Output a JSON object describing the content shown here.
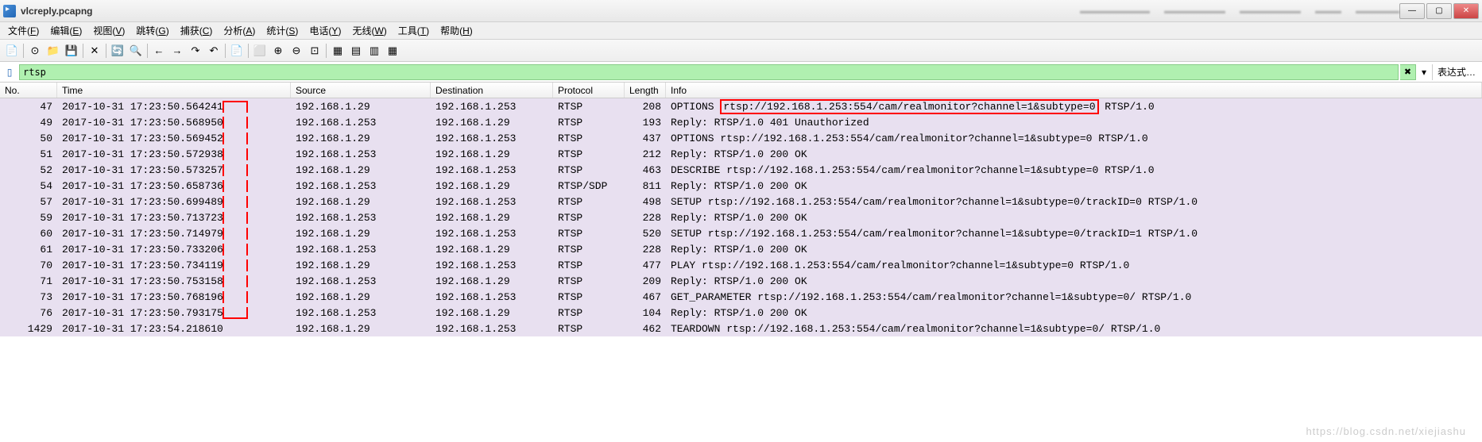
{
  "title": "vlcreply.pcapng",
  "blur_tabs": [
    "",
    "",
    "",
    "",
    ""
  ],
  "win_buttons": {
    "min": "—",
    "max": "▢",
    "close": "✕"
  },
  "menus": [
    {
      "label": "文件",
      "key": "F"
    },
    {
      "label": "编辑",
      "key": "E"
    },
    {
      "label": "视图",
      "key": "V"
    },
    {
      "label": "跳转",
      "key": "G"
    },
    {
      "label": "捕获",
      "key": "C"
    },
    {
      "label": "分析",
      "key": "A"
    },
    {
      "label": "统计",
      "key": "S"
    },
    {
      "label": "电话",
      "key": "Y"
    },
    {
      "label": "无线",
      "key": "W"
    },
    {
      "label": "工具",
      "key": "T"
    },
    {
      "label": "帮助",
      "key": "H"
    }
  ],
  "toolbar_icons": [
    "📄",
    "⊙",
    "📁",
    "💾",
    "✕",
    "🔄",
    "🔍",
    "←",
    "→",
    "↷",
    "↶",
    "📄",
    "⬜",
    "⊕",
    "⊖",
    "⊡",
    "▦",
    "▤",
    "▥",
    "▦"
  ],
  "filter": {
    "value": "rtsp",
    "expr_label": "表达式…"
  },
  "columns": [
    "No.",
    "Time",
    "Source",
    "Destination",
    "Protocol",
    "Length",
    "Info"
  ],
  "packets": [
    {
      "no": "47",
      "time": "2017-10-31 17:23:50.564241",
      "src": "192.168.1.29",
      "dst": "192.168.1.253",
      "proto": "RTSP",
      "len": "208",
      "info_pre": "OPTIONS ",
      "info_hl": "rtsp://192.168.1.253:554/cam/realmonitor?channel=1&subtype=0",
      "info_post": " RTSP/1.0",
      "cls": "hl-purple",
      "marker": "top"
    },
    {
      "no": "49",
      "time": "2017-10-31 17:23:50.568950",
      "src": "192.168.1.253",
      "dst": "192.168.1.29",
      "proto": "RTSP",
      "len": "193",
      "info": "Reply: RTSP/1.0 401 Unauthorized",
      "cls": "hl-purple"
    },
    {
      "no": "50",
      "time": "2017-10-31 17:23:50.569452",
      "src": "192.168.1.29",
      "dst": "192.168.1.253",
      "proto": "RTSP",
      "len": "437",
      "info": "OPTIONS rtsp://192.168.1.253:554/cam/realmonitor?channel=1&subtype=0 RTSP/1.0",
      "cls": "hl-purple"
    },
    {
      "no": "51",
      "time": "2017-10-31 17:23:50.572938",
      "src": "192.168.1.253",
      "dst": "192.168.1.29",
      "proto": "RTSP",
      "len": "212",
      "info": "Reply: RTSP/1.0 200 OK",
      "cls": "hl-purple"
    },
    {
      "no": "52",
      "time": "2017-10-31 17:23:50.573257",
      "src": "192.168.1.29",
      "dst": "192.168.1.253",
      "proto": "RTSP",
      "len": "463",
      "info": "DESCRIBE rtsp://192.168.1.253:554/cam/realmonitor?channel=1&subtype=0 RTSP/1.0",
      "cls": "hl-purple"
    },
    {
      "no": "54",
      "time": "2017-10-31 17:23:50.658736",
      "src": "192.168.1.253",
      "dst": "192.168.1.29",
      "proto": "RTSP/SDP",
      "len": "811",
      "info": "Reply: RTSP/1.0 200 OK",
      "cls": "hl-purple"
    },
    {
      "no": "57",
      "time": "2017-10-31 17:23:50.699489",
      "src": "192.168.1.29",
      "dst": "192.168.1.253",
      "proto": "RTSP",
      "len": "498",
      "info": "SETUP rtsp://192.168.1.253:554/cam/realmonitor?channel=1&subtype=0/trackID=0 RTSP/1.0",
      "cls": "hl-purple"
    },
    {
      "no": "59",
      "time": "2017-10-31 17:23:50.713723",
      "src": "192.168.1.253",
      "dst": "192.168.1.29",
      "proto": "RTSP",
      "len": "228",
      "info": "Reply: RTSP/1.0 200 OK",
      "cls": "hl-purple"
    },
    {
      "no": "60",
      "time": "2017-10-31 17:23:50.714979",
      "src": "192.168.1.29",
      "dst": "192.168.1.253",
      "proto": "RTSP",
      "len": "520",
      "info": "SETUP rtsp://192.168.1.253:554/cam/realmonitor?channel=1&subtype=0/trackID=1 RTSP/1.0",
      "cls": "hl-purple"
    },
    {
      "no": "61",
      "time": "2017-10-31 17:23:50.733206",
      "src": "192.168.1.253",
      "dst": "192.168.1.29",
      "proto": "RTSP",
      "len": "228",
      "info": "Reply: RTSP/1.0 200 OK",
      "cls": "hl-purple"
    },
    {
      "no": "70",
      "time": "2017-10-31 17:23:50.734119",
      "src": "192.168.1.29",
      "dst": "192.168.1.253",
      "proto": "RTSP",
      "len": "477",
      "info": "PLAY rtsp://192.168.1.253:554/cam/realmonitor?channel=1&subtype=0 RTSP/1.0",
      "cls": "hl-purple"
    },
    {
      "no": "71",
      "time": "2017-10-31 17:23:50.753158",
      "src": "192.168.1.253",
      "dst": "192.168.1.29",
      "proto": "RTSP",
      "len": "209",
      "info": "Reply: RTSP/1.0 200 OK",
      "cls": "hl-purple"
    },
    {
      "no": "73",
      "time": "2017-10-31 17:23:50.768196",
      "src": "192.168.1.29",
      "dst": "192.168.1.253",
      "proto": "RTSP",
      "len": "467",
      "info": "GET_PARAMETER rtsp://192.168.1.253:554/cam/realmonitor?channel=1&subtype=0/ RTSP/1.0",
      "cls": "hl-purple"
    },
    {
      "no": "76",
      "time": "2017-10-31 17:23:50.793175",
      "src": "192.168.1.253",
      "dst": "192.168.1.29",
      "proto": "RTSP",
      "len": "104",
      "info": "Reply: RTSP/1.0 200 OK",
      "cls": "hl-purple",
      "marker": "bottom"
    },
    {
      "no": "1429",
      "time": "2017-10-31 17:23:54.218610",
      "src": "192.168.1.29",
      "dst": "192.168.1.253",
      "proto": "RTSP",
      "len": "462",
      "info": "TEARDOWN rtsp://192.168.1.253:554/cam/realmonitor?channel=1&subtype=0/ RTSP/1.0",
      "cls": "hl-purple"
    }
  ],
  "watermark": "https://blog.csdn.net/xiejiashu"
}
